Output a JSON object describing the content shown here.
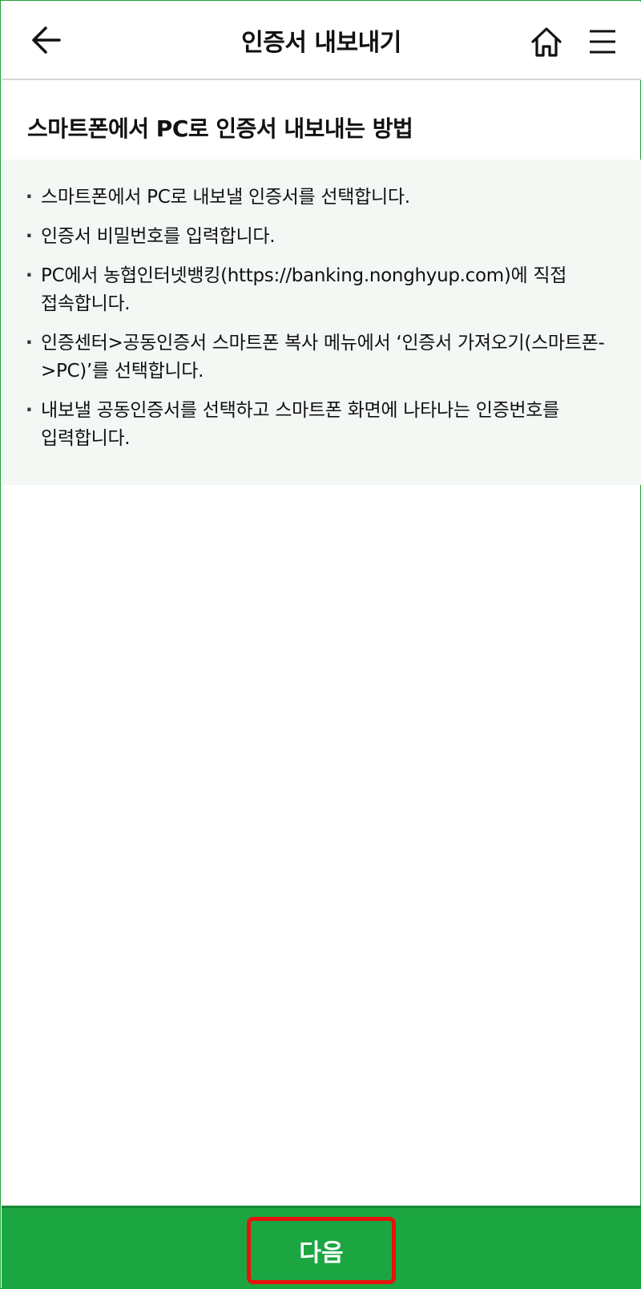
{
  "header": {
    "title": "인증서 내보내기",
    "back_icon": "arrow-left-icon",
    "home_icon": "home-icon",
    "menu_icon": "hamburger-menu-icon"
  },
  "section": {
    "title": "스마트폰에서 PC로 인증서 내보내는 방법"
  },
  "steps": [
    {
      "bullet": "·",
      "text": "스마트폰에서 PC로 내보낼 인증서를 선택합니다."
    },
    {
      "bullet": "·",
      "text": "인증서 비밀번호를 입력합니다."
    },
    {
      "bullet": "·",
      "text": "PC에서 농협인터넷뱅킹(https://banking.nonghyup.com)에 직접 접속합니다."
    },
    {
      "bullet": "·",
      "text": "인증센터>공동인증서 스마트폰 복사 메뉴에서 ‘인증서 가져오기(스마트폰->PC)’를 선택합니다."
    },
    {
      "bullet": "·",
      "text": "내보낼 공동인증서를 선택하고 스마트폰 화면에 나타나는 인증번호를 입력합니다."
    }
  ],
  "footer": {
    "next_label": "다음"
  },
  "colors": {
    "accent_green": "#1ca642",
    "highlight_red": "#e8120c",
    "info_box_bg": "#f4f8f5"
  }
}
